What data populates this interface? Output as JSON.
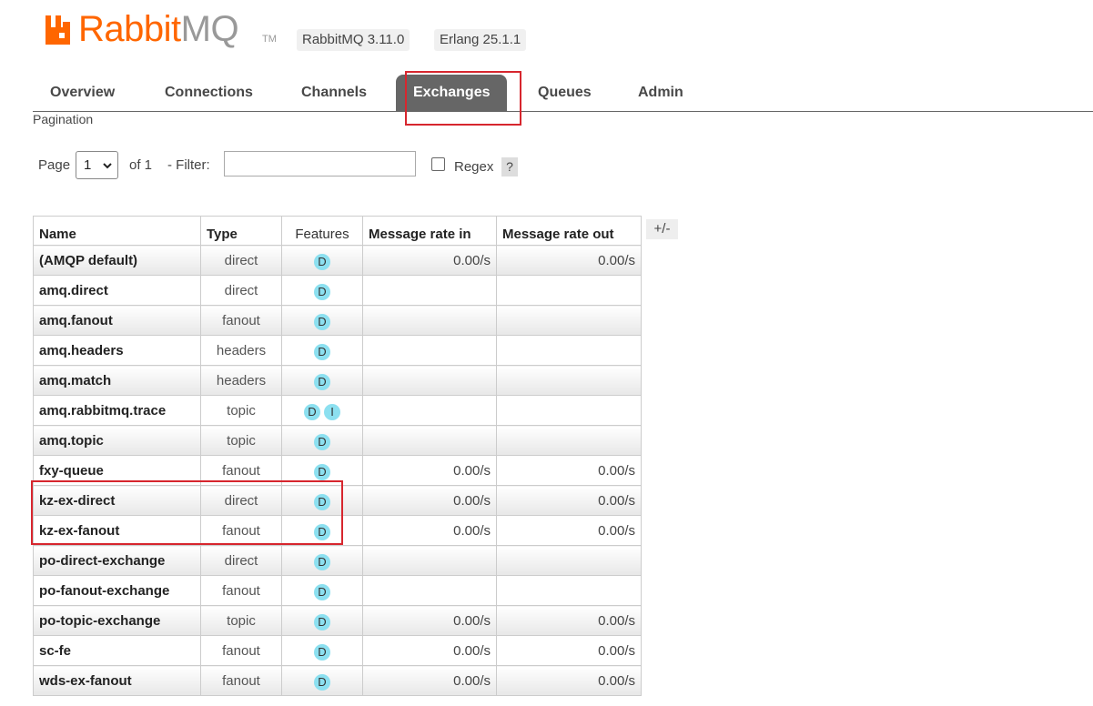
{
  "header": {
    "logo_rabbit": "Rabbit",
    "logo_mq": "MQ",
    "logo_tm": "TM",
    "rabbitmq_version": "RabbitMQ 3.11.0",
    "erlang_version": "Erlang 25.1.1",
    "brand_color": "#ff6600"
  },
  "nav": {
    "tabs": [
      {
        "label": "Overview"
      },
      {
        "label": "Connections"
      },
      {
        "label": "Channels"
      },
      {
        "label": "Exchanges",
        "active": true
      },
      {
        "label": "Queues"
      },
      {
        "label": "Admin"
      }
    ]
  },
  "pagination": {
    "title": "Pagination",
    "page_label": "Page",
    "page_value": "1",
    "of_label": "of 1",
    "filter_label": "- Filter:",
    "filter_value": "",
    "regex_label": "Regex",
    "regex_checked": false,
    "help_label": "?"
  },
  "table": {
    "columns": {
      "name": "Name",
      "type": "Type",
      "features": "Features",
      "rate_in": "Message rate in",
      "rate_out": "Message rate out"
    },
    "toggle_label": "+/-",
    "rows": [
      {
        "name": "(AMQP default)",
        "type": "direct",
        "features": [
          "D"
        ],
        "rate_in": "0.00/s",
        "rate_out": "0.00/s"
      },
      {
        "name": "amq.direct",
        "type": "direct",
        "features": [
          "D"
        ],
        "rate_in": "",
        "rate_out": ""
      },
      {
        "name": "amq.fanout",
        "type": "fanout",
        "features": [
          "D"
        ],
        "rate_in": "",
        "rate_out": ""
      },
      {
        "name": "amq.headers",
        "type": "headers",
        "features": [
          "D"
        ],
        "rate_in": "",
        "rate_out": ""
      },
      {
        "name": "amq.match",
        "type": "headers",
        "features": [
          "D"
        ],
        "rate_in": "",
        "rate_out": ""
      },
      {
        "name": "amq.rabbitmq.trace",
        "type": "topic",
        "features": [
          "D",
          "I"
        ],
        "rate_in": "",
        "rate_out": ""
      },
      {
        "name": "amq.topic",
        "type": "topic",
        "features": [
          "D"
        ],
        "rate_in": "",
        "rate_out": ""
      },
      {
        "name": "fxy-queue",
        "type": "fanout",
        "features": [
          "D"
        ],
        "rate_in": "0.00/s",
        "rate_out": "0.00/s"
      },
      {
        "name": "kz-ex-direct",
        "type": "direct",
        "features": [
          "D"
        ],
        "rate_in": "0.00/s",
        "rate_out": "0.00/s"
      },
      {
        "name": "kz-ex-fanout",
        "type": "fanout",
        "features": [
          "D"
        ],
        "rate_in": "0.00/s",
        "rate_out": "0.00/s"
      },
      {
        "name": "po-direct-exchange",
        "type": "direct",
        "features": [
          "D"
        ],
        "rate_in": "",
        "rate_out": ""
      },
      {
        "name": "po-fanout-exchange",
        "type": "fanout",
        "features": [
          "D"
        ],
        "rate_in": "",
        "rate_out": ""
      },
      {
        "name": "po-topic-exchange",
        "type": "topic",
        "features": [
          "D"
        ],
        "rate_in": "0.00/s",
        "rate_out": "0.00/s"
      },
      {
        "name": "sc-fe",
        "type": "fanout",
        "features": [
          "D"
        ],
        "rate_in": "0.00/s",
        "rate_out": "0.00/s"
      },
      {
        "name": "wds-ex-fanout",
        "type": "fanout",
        "features": [
          "D"
        ],
        "rate_in": "0.00/s",
        "rate_out": "0.00/s"
      }
    ]
  }
}
